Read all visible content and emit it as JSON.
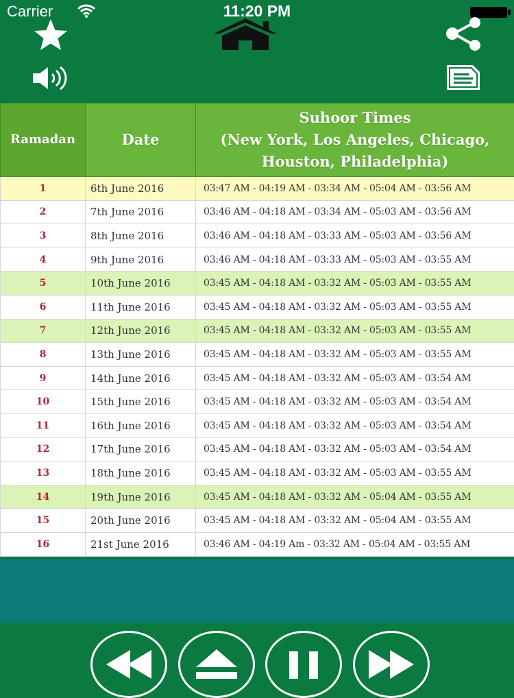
{
  "status_bar": {
    "carrier": "Carrier",
    "time": "11:20 PM"
  },
  "toolbar": {
    "favorite_icon": "star-icon",
    "home_icon": "home-icon",
    "share_icon": "share-icon",
    "sound_icon": "speaker-icon",
    "notes_icon": "document-icon"
  },
  "table": {
    "headers": {
      "ramadan": "Ramadan",
      "date": "Date",
      "times_line1": "Suhoor Times",
      "times_line2": "(New York, Los Angeles, Chicago,",
      "times_line3": "Houston, Philadelphia)"
    },
    "rows": [
      {
        "day": "1",
        "date": "6th June 2016",
        "times": "03:47 AM - 04:19 AM - 03:34 AM - 05:04 AM - 03:56 AM",
        "style": "yellow"
      },
      {
        "day": "2",
        "date": "7th June 2016",
        "times": "03:46 AM - 04:18 AM - 03:34 AM - 05:03 AM - 03:56 AM",
        "style": "white"
      },
      {
        "day": "3",
        "date": "8th June 2016",
        "times": "03:46 AM - 04:18 AM - 03:33 AM - 05:03 AM - 03:56 AM",
        "style": "white"
      },
      {
        "day": "4",
        "date": "9th June 2016",
        "times": "03:46 AM - 04:18 AM - 03:33 AM - 05:03 AM - 03:55 AM",
        "style": "white"
      },
      {
        "day": "5",
        "date": "10th June 2016",
        "times": "03:45 AM - 04:18 AM - 03:32 AM - 05:03 AM - 03:55 AM",
        "style": "green"
      },
      {
        "day": "6",
        "date": "11th June 2016",
        "times": "03:45 AM - 04:18 AM - 03:32 AM - 05:03 AM - 03:55 AM",
        "style": "white"
      },
      {
        "day": "7",
        "date": "12th June 2016",
        "times": "03:45 AM - 04:18 AM - 03:32 AM - 05:03 AM - 03:55 AM",
        "style": "green"
      },
      {
        "day": "8",
        "date": "13th June 2016",
        "times": "03:45 AM - 04:18 AM - 03:32 AM - 05:03 AM - 03:55 AM",
        "style": "white"
      },
      {
        "day": "9",
        "date": "14th June 2016",
        "times": "03:45 AM - 04:18 AM - 03:32 AM - 05:03 AM - 03:54 AM",
        "style": "white"
      },
      {
        "day": "10",
        "date": "15th June 2016",
        "times": "03:45 AM - 04:18 AM - 03:32 AM - 05:03 AM - 03:54 AM",
        "style": "white"
      },
      {
        "day": "11",
        "date": "16th June 2016",
        "times": "03:45 AM - 04:18 AM - 03:32 AM - 05:03 AM - 03:54 AM",
        "style": "white"
      },
      {
        "day": "12",
        "date": "17th June 2016",
        "times": "03:45 AM - 04:18 AM - 03:32 AM - 05:03 AM - 03:54 AM",
        "style": "white"
      },
      {
        "day": "13",
        "date": "18th June 2016",
        "times": "03:45 AM - 04:18 AM - 03:32 AM - 05:03 AM - 03:55 AM",
        "style": "white"
      },
      {
        "day": "14",
        "date": "19th June 2016",
        "times": "03:45 AM - 04:18 AM - 03:32 AM - 05:04 AM - 03:55 AM",
        "style": "green"
      },
      {
        "day": "15",
        "date": "20th June 2016",
        "times": "03:45 AM - 04:18 AM - 03:32 AM - 05:04 AM - 03:55 AM",
        "style": "white"
      },
      {
        "day": "16",
        "date": "21st June 2016",
        "times": "03:46 AM - 04:19 Am - 03:32 AM - 05:04 AM - 03:55 AM",
        "style": "white"
      }
    ]
  },
  "player": {
    "rewind_icon": "rewind-icon",
    "eject_icon": "eject-icon",
    "pause_icon": "pause-icon",
    "forward_icon": "fast-forward-icon"
  },
  "colors": {
    "header_bg": "#0a7a40",
    "table_header_bg": "#6ab63c",
    "row_green": "#dcf3b8",
    "row_yellow": "#fffbc0",
    "day_number": "#b3232e",
    "teal_band": "#0d7a79"
  }
}
